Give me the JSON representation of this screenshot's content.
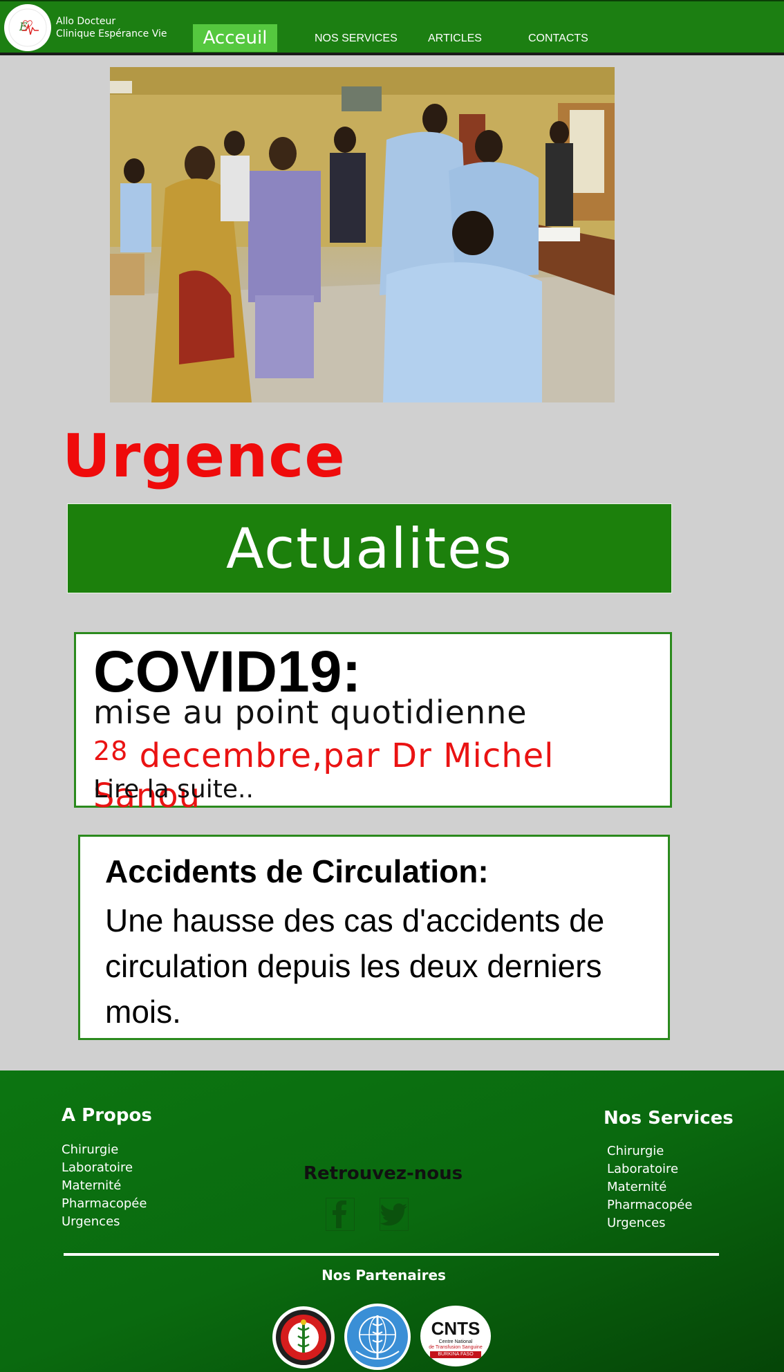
{
  "header": {
    "brand_line1": "Allo Docteur",
    "brand_line2": "Clinique Espérance Vie",
    "logo_text": "EV",
    "nav": {
      "home": "Acceuil",
      "services": "NOS SERVICES",
      "articles": "ARTICLES",
      "contacts": "CONTACTS"
    }
  },
  "hero": {
    "image_description_icon": "photo-image"
  },
  "main": {
    "urgence_title": "Urgence",
    "actualites_title": "Actualites",
    "covid": {
      "title": "COVID19:",
      "subtitle": "mise au point quotidienne",
      "date_day": "28",
      "date_rest": " decembre,par Dr Michel Sanou",
      "read_more": "Lire la suite.."
    },
    "accident": {
      "title": "Accidents de Circulation:",
      "body": "Une hausse des cas d'accidents de circulation depuis les deux derniers mois."
    }
  },
  "footer": {
    "about_title": "A Propos",
    "about_items": [
      "Chirurgie",
      "Laboratoire",
      "Maternité",
      "Pharmacopée",
      "Urgences"
    ],
    "services_title": "Nos Services",
    "services_items": [
      "Chirurgie",
      "Laboratoire",
      "Maternité",
      "Pharmacopée",
      "Urgences"
    ],
    "social_title": "Retrouvez-nous",
    "partners_title": "Nos Partenaires",
    "partner3_text": "CNTS",
    "partner3_sub1": "Centre National",
    "partner3_sub2": "de Transfusion Sanguine",
    "partner3_sub3": "BURKINA FASO"
  },
  "colors": {
    "header_green": "#1c7f12",
    "active_nav": "#55c83f",
    "urgence_red": "#ef0b0b",
    "actualites_green": "#1c800c",
    "card_border": "#2b8a1d",
    "footer_green": "#0a6a0f",
    "page_bg": "#d0d0d0"
  }
}
